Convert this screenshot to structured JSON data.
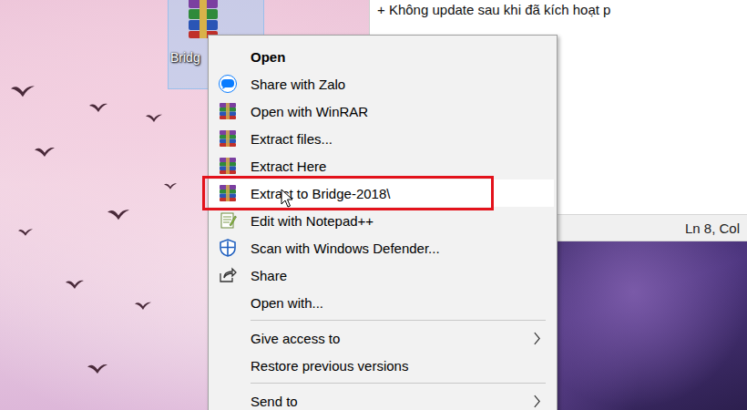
{
  "desktop": {
    "icon": {
      "label": "Bridg",
      "selected": true
    }
  },
  "notepad": {
    "text": "+ Không update sau khi đã kích hoạt p",
    "status_bar": {
      "position": "Ln 8, Col"
    }
  },
  "context_menu": {
    "items": [
      {
        "kind": "item",
        "label": "Open",
        "default": true,
        "selected": false,
        "submenu": false,
        "annotated": false
      },
      {
        "kind": "item",
        "label": "Share with Zalo",
        "default": false,
        "selected": false,
        "submenu": false,
        "annotated": false
      },
      {
        "kind": "item",
        "label": "Open with WinRAR",
        "default": false,
        "selected": false,
        "submenu": false,
        "annotated": false
      },
      {
        "kind": "item",
        "label": "Extract files...",
        "default": false,
        "selected": false,
        "submenu": false,
        "annotated": false
      },
      {
        "kind": "item",
        "label": "Extract Here",
        "default": false,
        "selected": false,
        "submenu": false,
        "annotated": false
      },
      {
        "kind": "item",
        "label": "Extract to Bridge-2018\\",
        "default": false,
        "selected": true,
        "submenu": false,
        "annotated": true
      },
      {
        "kind": "item",
        "label": "Edit with Notepad++",
        "default": false,
        "selected": false,
        "submenu": false,
        "annotated": false
      },
      {
        "kind": "item",
        "label": "Scan with Windows Defender...",
        "default": false,
        "selected": false,
        "submenu": false,
        "annotated": false
      },
      {
        "kind": "item",
        "label": "Share",
        "default": false,
        "selected": false,
        "submenu": false,
        "annotated": false
      },
      {
        "kind": "item",
        "label": "Open with...",
        "default": false,
        "selected": false,
        "submenu": false,
        "annotated": false
      },
      {
        "kind": "separator",
        "selected": false
      },
      {
        "kind": "item",
        "label": "Give access to",
        "default": false,
        "selected": false,
        "submenu": true,
        "annotated": false
      },
      {
        "kind": "item",
        "label": "Restore previous versions",
        "default": false,
        "selected": false,
        "submenu": false,
        "annotated": false
      },
      {
        "kind": "separator",
        "selected": false
      },
      {
        "kind": "item",
        "label": "Send to",
        "default": false,
        "selected": false,
        "submenu": true,
        "annotated": false
      }
    ]
  }
}
